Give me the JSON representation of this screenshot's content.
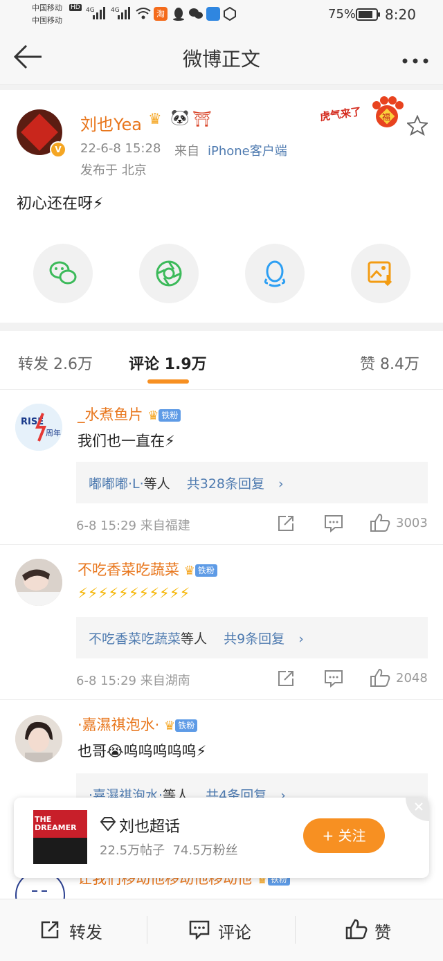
{
  "status_bar": {
    "carrier1": "中国移动",
    "carrier2": "中国移动",
    "net1": "HD",
    "sig1": "4G",
    "sig2": "4G",
    "battery": "75%",
    "time": "8:20"
  },
  "nav": {
    "title": "微博正文"
  },
  "post": {
    "username": "刘也Yea",
    "time": "22-6-8 15:28",
    "from_label": "来自",
    "source": "iPhone客户端",
    "location": "发布于 北京",
    "text": "初心还在呀⚡",
    "sticker": "虎气来了",
    "sticker_glyph": "福"
  },
  "share_icons": [
    "wechat-icon",
    "moments-icon",
    "qq-icon",
    "save-image-icon"
  ],
  "tabs": {
    "repost": "转发 2.6万",
    "comment": "评论 1.9万",
    "like": "赞 8.4万"
  },
  "comments": [
    {
      "name": "_水煮鱼片",
      "badge": "铁粉",
      "text": "我们也一直在⚡",
      "reply_user": "嘟嘟嘟·L·",
      "reply_mid": "等人",
      "reply_count": "共328条回复",
      "meta": "6-8 15:29 来自福建",
      "likes": "3003"
    },
    {
      "name": "不吃香菜吃蔬菜",
      "badge": "铁粉",
      "text": "⚡⚡⚡⚡⚡⚡⚡⚡⚡⚡⚡",
      "reply_user": "不吃香菜吃蔬菜",
      "reply_mid": "等人",
      "reply_count": "共9条回复",
      "meta": "6-8 15:29 来自湖南",
      "likes": "2048"
    },
    {
      "name": "·嘉濕祺泡水·",
      "badge": "铁粉",
      "text": "也哥😭呜呜呜呜呜⚡",
      "reply_user": "·嘉濕祺泡水·",
      "reply_mid": "等人",
      "reply_count": "共4条回复"
    },
    {
      "name": "让我们移动他移动他移动他",
      "badge": "铁粉"
    }
  ],
  "popup": {
    "title": "刘也超话",
    "stats": "22.5万帖子  74.5万粉丝",
    "follow": "+ 关注",
    "thumb_text": "THE DREAMER"
  },
  "bottom_bar": {
    "repost": "转发",
    "comment": "评论",
    "like": "赞"
  },
  "colors": {
    "accent_orange": "#f79022",
    "link_blue": "#4f7bb0",
    "badge_blue": "#5e9be6",
    "share_green": "#3cba5a"
  }
}
